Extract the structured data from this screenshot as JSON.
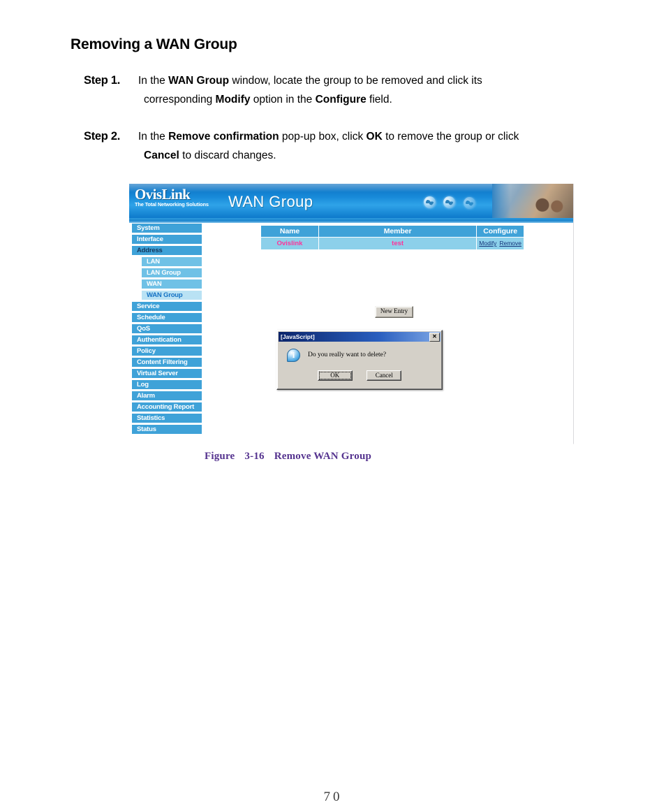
{
  "document": {
    "heading": "Removing a WAN Group",
    "page_number": "70",
    "steps": [
      {
        "label": "Step 1.",
        "line1_a": "In the ",
        "line1_b": "WAN Group",
        "line1_c": " window, locate the group to be removed and click its",
        "line2_a": "corresponding ",
        "line2_b": "Modify",
        "line2_c": " option in the ",
        "line2_d": "Configure",
        "line2_e": " field."
      },
      {
        "label": "Step 2.",
        "line1_a": "In the ",
        "line1_b": "Remove confirmation",
        "line1_c": " pop-up box, click ",
        "line1_d": "OK",
        "line1_e": " to remove the group or click",
        "line2_a": "Cancel",
        "line2_b": " to discard changes."
      }
    ],
    "figure_caption": {
      "word": "Figure",
      "number": "3-16",
      "title": "Remove WAN Group"
    }
  },
  "screenshot": {
    "banner": {
      "logo_name": "OvisLink",
      "logo_tagline": "The Total Networking Solutions",
      "title": "WAN Group"
    },
    "sidebar": {
      "items": [
        {
          "label": "System",
          "type": "main"
        },
        {
          "label": "Interface",
          "type": "main"
        },
        {
          "label": "Address",
          "type": "main-selected"
        },
        {
          "label": "LAN",
          "type": "sub"
        },
        {
          "label": "LAN Group",
          "type": "sub"
        },
        {
          "label": "WAN",
          "type": "sub"
        },
        {
          "label": "WAN Group",
          "type": "sub-active"
        },
        {
          "label": "Service",
          "type": "main"
        },
        {
          "label": "Schedule",
          "type": "main"
        },
        {
          "label": "QoS",
          "type": "main"
        },
        {
          "label": "Authentication",
          "type": "main"
        },
        {
          "label": "Policy",
          "type": "main"
        },
        {
          "label": "Content Filtering",
          "type": "main"
        },
        {
          "label": "Virtual Server",
          "type": "main"
        },
        {
          "label": "Log",
          "type": "main"
        },
        {
          "label": "Alarm",
          "type": "main"
        },
        {
          "label": "Accounting Report",
          "type": "main"
        },
        {
          "label": "Statistics",
          "type": "main"
        },
        {
          "label": "Status",
          "type": "main"
        }
      ]
    },
    "table": {
      "headers": [
        "Name",
        "Member",
        "Configure"
      ],
      "rows": [
        {
          "name": "Ovislink",
          "member": "test",
          "modify_label": "Modify",
          "remove_label": "Remove"
        }
      ]
    },
    "new_entry_button": "New Entry",
    "dialog": {
      "title": "[JavaScript]",
      "close_label": "✕",
      "icon": "info-icon",
      "message": "Do you really want to delete?",
      "ok_label": "OK",
      "cancel_label": "Cancel"
    },
    "colors": {
      "banner_blue": "#1789d8",
      "nav_blue": "#3fa2d8",
      "nav_sub_blue": "#6fc1e6",
      "nav_active_bg": "#b9e2f4",
      "row_blue": "#8cd0ea",
      "row_text_pink": "#ff3399",
      "link_blue": "#14357a",
      "caption_purple": "#55338f",
      "dialog_face": "#d4d0c8"
    }
  }
}
